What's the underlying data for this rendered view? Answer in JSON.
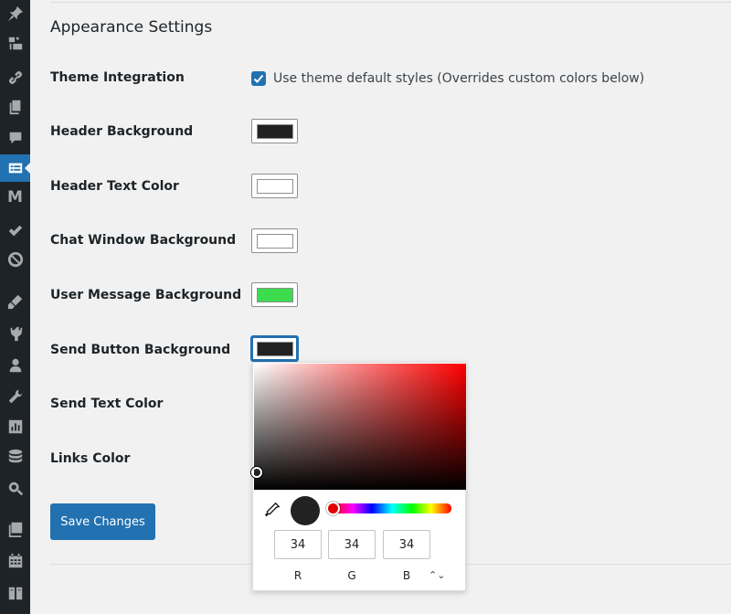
{
  "sidebar": {
    "items": [
      {
        "icon": "pin-icon"
      },
      {
        "icon": "media-icon"
      },
      {
        "icon": "link-icon"
      },
      {
        "icon": "pages-icon"
      },
      {
        "icon": "comments-icon"
      },
      {
        "icon": "chat-plugin-icon",
        "active": true
      },
      {
        "icon": "m-plugin-icon",
        "letter": "M"
      },
      {
        "icon": "checkmark-icon"
      },
      {
        "icon": "block-icon"
      },
      {
        "icon": "appearance-icon"
      },
      {
        "icon": "plugins-icon"
      },
      {
        "icon": "users-icon"
      },
      {
        "icon": "tools-icon"
      },
      {
        "icon": "settings-icon"
      },
      {
        "icon": "database-icon"
      },
      {
        "icon": "search-icon"
      },
      {
        "icon": "gallery-icon"
      },
      {
        "icon": "calendar-icon"
      },
      {
        "icon": "book-icon"
      }
    ]
  },
  "page": {
    "title": "Appearance Settings"
  },
  "settings": {
    "theme_integration": {
      "label": "Theme Integration",
      "checked": true,
      "checkbox_text": "Use theme default styles (Overrides custom colors below)"
    },
    "header_background": {
      "label": "Header Background",
      "color": "#222222"
    },
    "header_text_color": {
      "label": "Header Text Color",
      "color": "#ffffff"
    },
    "chat_window_background": {
      "label": "Chat Window Background",
      "color": "#ffffff"
    },
    "user_message_background": {
      "label": "User Message Background",
      "color": "#3ddc4e"
    },
    "send_button_background": {
      "label": "Send Button Background",
      "color": "#222222"
    },
    "send_text_color": {
      "label": "Send Text Color"
    },
    "links_color": {
      "label": "Links Color"
    }
  },
  "actions": {
    "save_label": "Save Changes"
  },
  "color_picker": {
    "r_value": "34",
    "g_value": "34",
    "b_value": "34",
    "r_label": "R",
    "g_label": "G",
    "b_label": "B",
    "mode_toggle": "⌃⌄",
    "preview_color": "#222222",
    "hue_color": "#e00000"
  },
  "colors": {
    "accent": "#2271b1",
    "sidebar_bg": "#1d2327",
    "page_bg": "#f1f1f1"
  }
}
